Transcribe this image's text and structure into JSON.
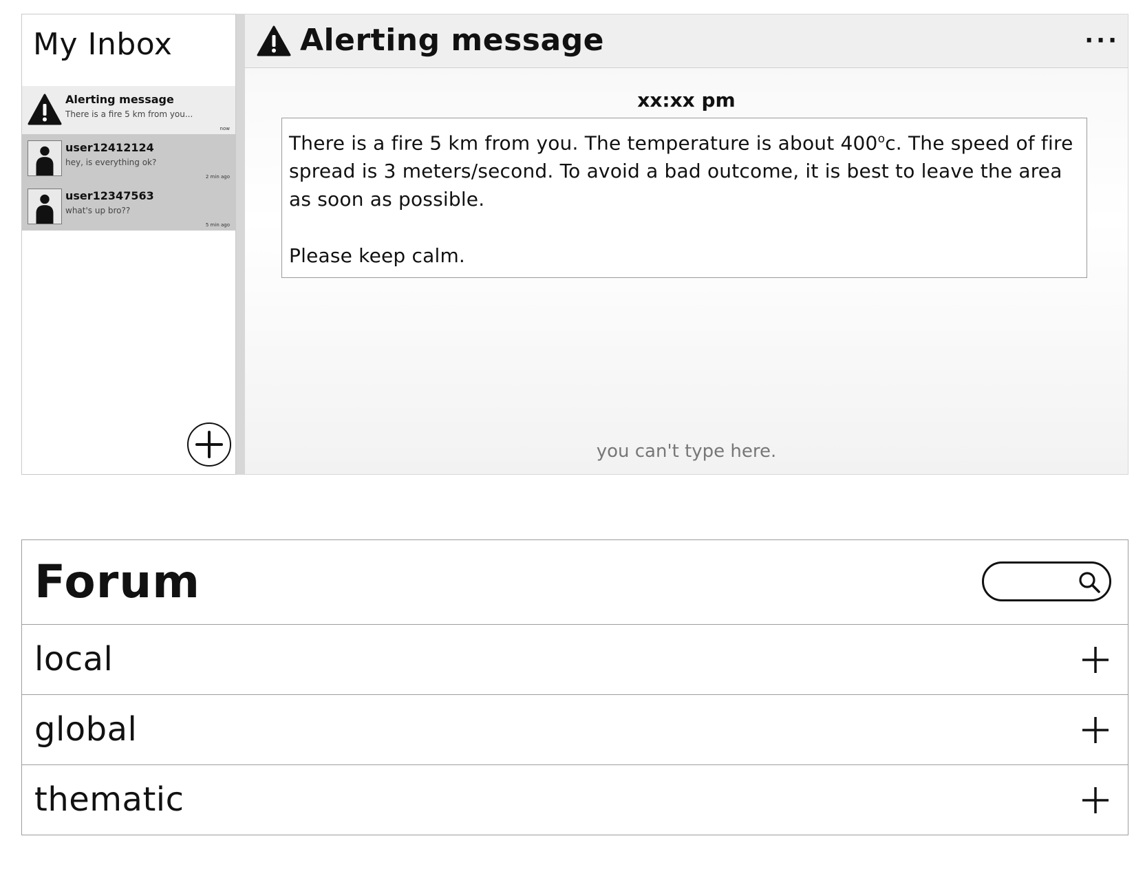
{
  "inbox": {
    "title": "My Inbox",
    "items": [
      {
        "icon": "warning-icon",
        "name": "Alerting message",
        "preview": "There is a fire 5 km from you...",
        "time": "now"
      },
      {
        "icon": "user-avatar-icon",
        "name": "user12412124",
        "preview": "hey, is everything ok?",
        "time": "2 min ago"
      },
      {
        "icon": "user-avatar-icon",
        "name": "user12347563",
        "preview": "what's up bro??",
        "time": "5 min ago"
      }
    ],
    "add_button_icon": "plus-circle-icon"
  },
  "message": {
    "header_icon": "warning-icon",
    "title": "Alerting message",
    "more_icon": "more-dots-icon",
    "more_label": "···",
    "time": "xx:xx pm",
    "body_part1": "There is a fire 5 km from you. The temperature is about 400",
    "body_degree": "o",
    "body_part2": "c.  The speed of fire spread is 3 meters/second.  To avoid a bad outcome, it is best to leave the area as soon as possible.",
    "body_closing": "Please keep calm.",
    "compose_hint": "you can't type here."
  },
  "forum": {
    "title": "Forum",
    "search": {
      "placeholder": "",
      "icon": "search-icon"
    },
    "categories": [
      {
        "label": "local",
        "icon": "plus-icon"
      },
      {
        "label": "global",
        "icon": "plus-icon"
      },
      {
        "label": "thematic",
        "icon": "plus-icon"
      }
    ]
  },
  "colors": {
    "text": "#111111",
    "inbox_item_bg": "#c9c9c9",
    "inbox_active_bg": "#ededed",
    "header_bg": "#efefef",
    "hint_text": "#777777",
    "border": "#9d9d9d"
  }
}
